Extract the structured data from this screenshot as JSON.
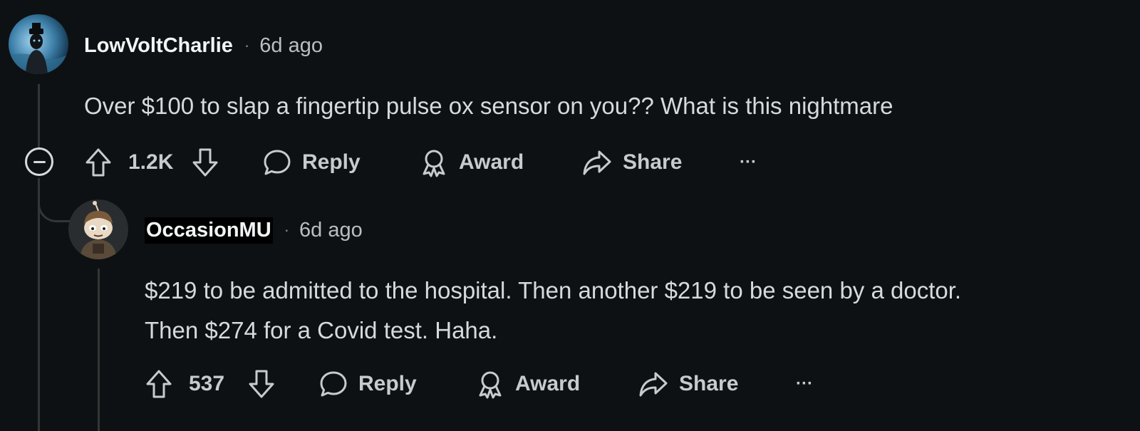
{
  "comments": [
    {
      "username": "LowVoltCharlie",
      "separator": "·",
      "time": "6d ago",
      "body_lines": [
        "Over $100 to slap a fingertip pulse ox sensor on you?? What is this nightmare"
      ],
      "votes": "1.2K",
      "reply_label": "Reply",
      "award_label": "Award",
      "share_label": "Share",
      "more_label": "···"
    },
    {
      "username": "OccasionMU",
      "separator": "·",
      "time": "6d ago",
      "body_lines": [
        "$219 to be admitted to the hospital. Then another $219 to be seen by a doctor.",
        "Then $274 for a Covid test. Haha."
      ],
      "votes": "537",
      "reply_label": "Reply",
      "award_label": "Award",
      "share_label": "Share",
      "more_label": "···"
    }
  ]
}
